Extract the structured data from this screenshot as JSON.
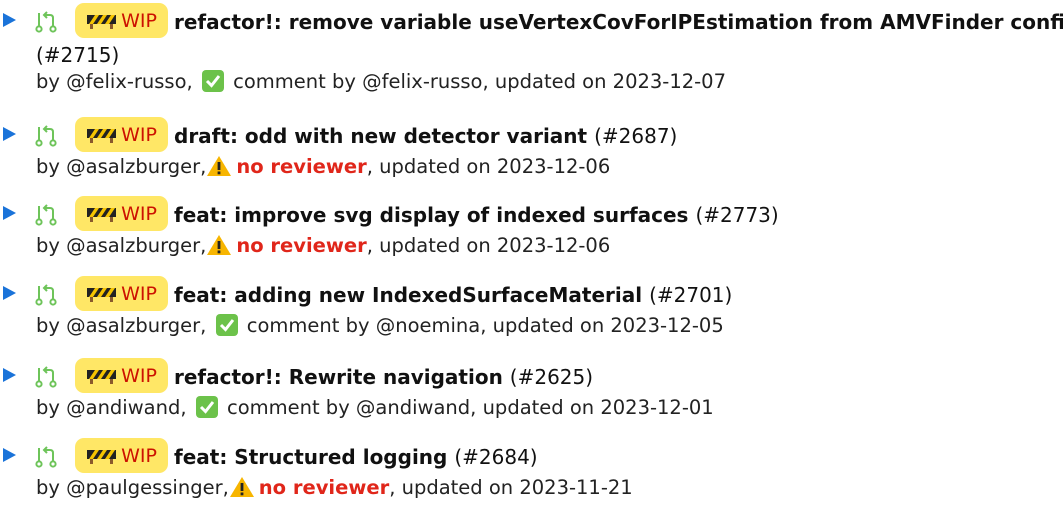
{
  "wip_label": "WIP",
  "colors": {
    "expand": "#1a73d9",
    "merge_icon": "#6ec45a",
    "wip_bg": "#ffe766",
    "wip_text": "#cc1100",
    "no_reviewer": "#e0261a",
    "approved": "#6cc24a"
  },
  "icons": {
    "expand": "triangle-right-icon",
    "merge_request": "merge-request-icon",
    "wip": "construction-barrier-icon",
    "approved": "check-mark-icon",
    "warning": "warning-icon"
  },
  "prs": [
    {
      "title": "refactor!: remove variable useVertexCovForIPEstimation from AMVFinder config",
      "number": "(#2715)",
      "by": "by @felix-russo,",
      "status": "approved",
      "status_text": "comment by @felix-russo,",
      "updated": "updated on 2023-12-07"
    },
    {
      "title": "draft: odd with new detector variant",
      "number": "(#2687)",
      "by": "by @asalzburger,",
      "status": "warning",
      "status_text": "no reviewer",
      "updated": ", updated on 2023-12-06"
    },
    {
      "title": "feat: improve svg display of indexed surfaces",
      "number": "(#2773)",
      "by": "by @asalzburger,",
      "status": "warning",
      "status_text": "no reviewer",
      "updated": ", updated on 2023-12-06"
    },
    {
      "title": "feat: adding new IndexedSurfaceMaterial",
      "number": "(#2701)",
      "by": "by @asalzburger,",
      "status": "approved",
      "status_text": "comment by @noemina,",
      "updated": "updated on 2023-12-05"
    },
    {
      "title": "refactor!: Rewrite navigation",
      "number": "(#2625)",
      "by": "by @andiwand,",
      "status": "approved",
      "status_text": "comment by @andiwand,",
      "updated": "updated on 2023-12-01"
    },
    {
      "title": "feat: Structured logging",
      "number": "(#2684)",
      "by": "by @paulgessinger,",
      "status": "warning",
      "status_text": "no reviewer",
      "updated": ", updated on 2023-11-21"
    }
  ]
}
